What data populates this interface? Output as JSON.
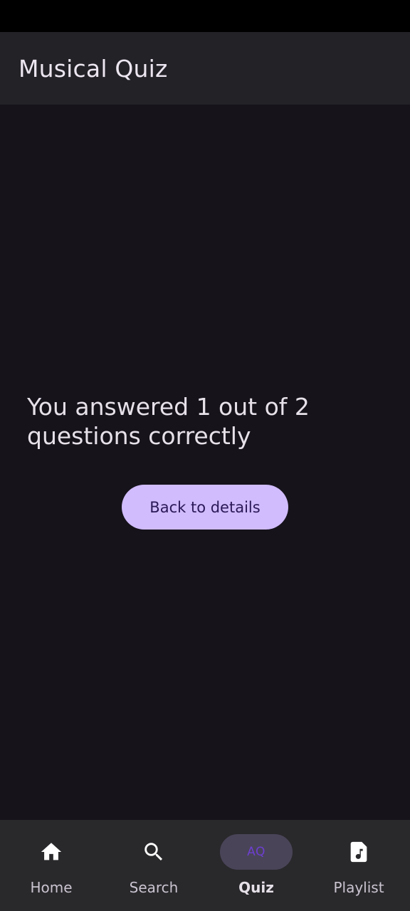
{
  "app_bar": {
    "title": "Musical Quiz"
  },
  "result": {
    "message": "You answered 1 out of 2 questions correctly",
    "button_label": "Back to details"
  },
  "bottom_nav": {
    "items": [
      {
        "label": "Home",
        "icon": "home-icon",
        "active": false
      },
      {
        "label": "Search",
        "icon": "search-icon",
        "active": false
      },
      {
        "label": "Quiz",
        "icon": "quiz-icon",
        "icon_text": "AQ",
        "active": true
      },
      {
        "label": "Playlist",
        "icon": "music-file-icon",
        "active": false
      }
    ]
  },
  "colors": {
    "background": "#16131b",
    "app_bar": "#232227",
    "button": "#d1bcfd",
    "nav_background": "#29282b",
    "nav_active_indicator": "#4a4458"
  }
}
